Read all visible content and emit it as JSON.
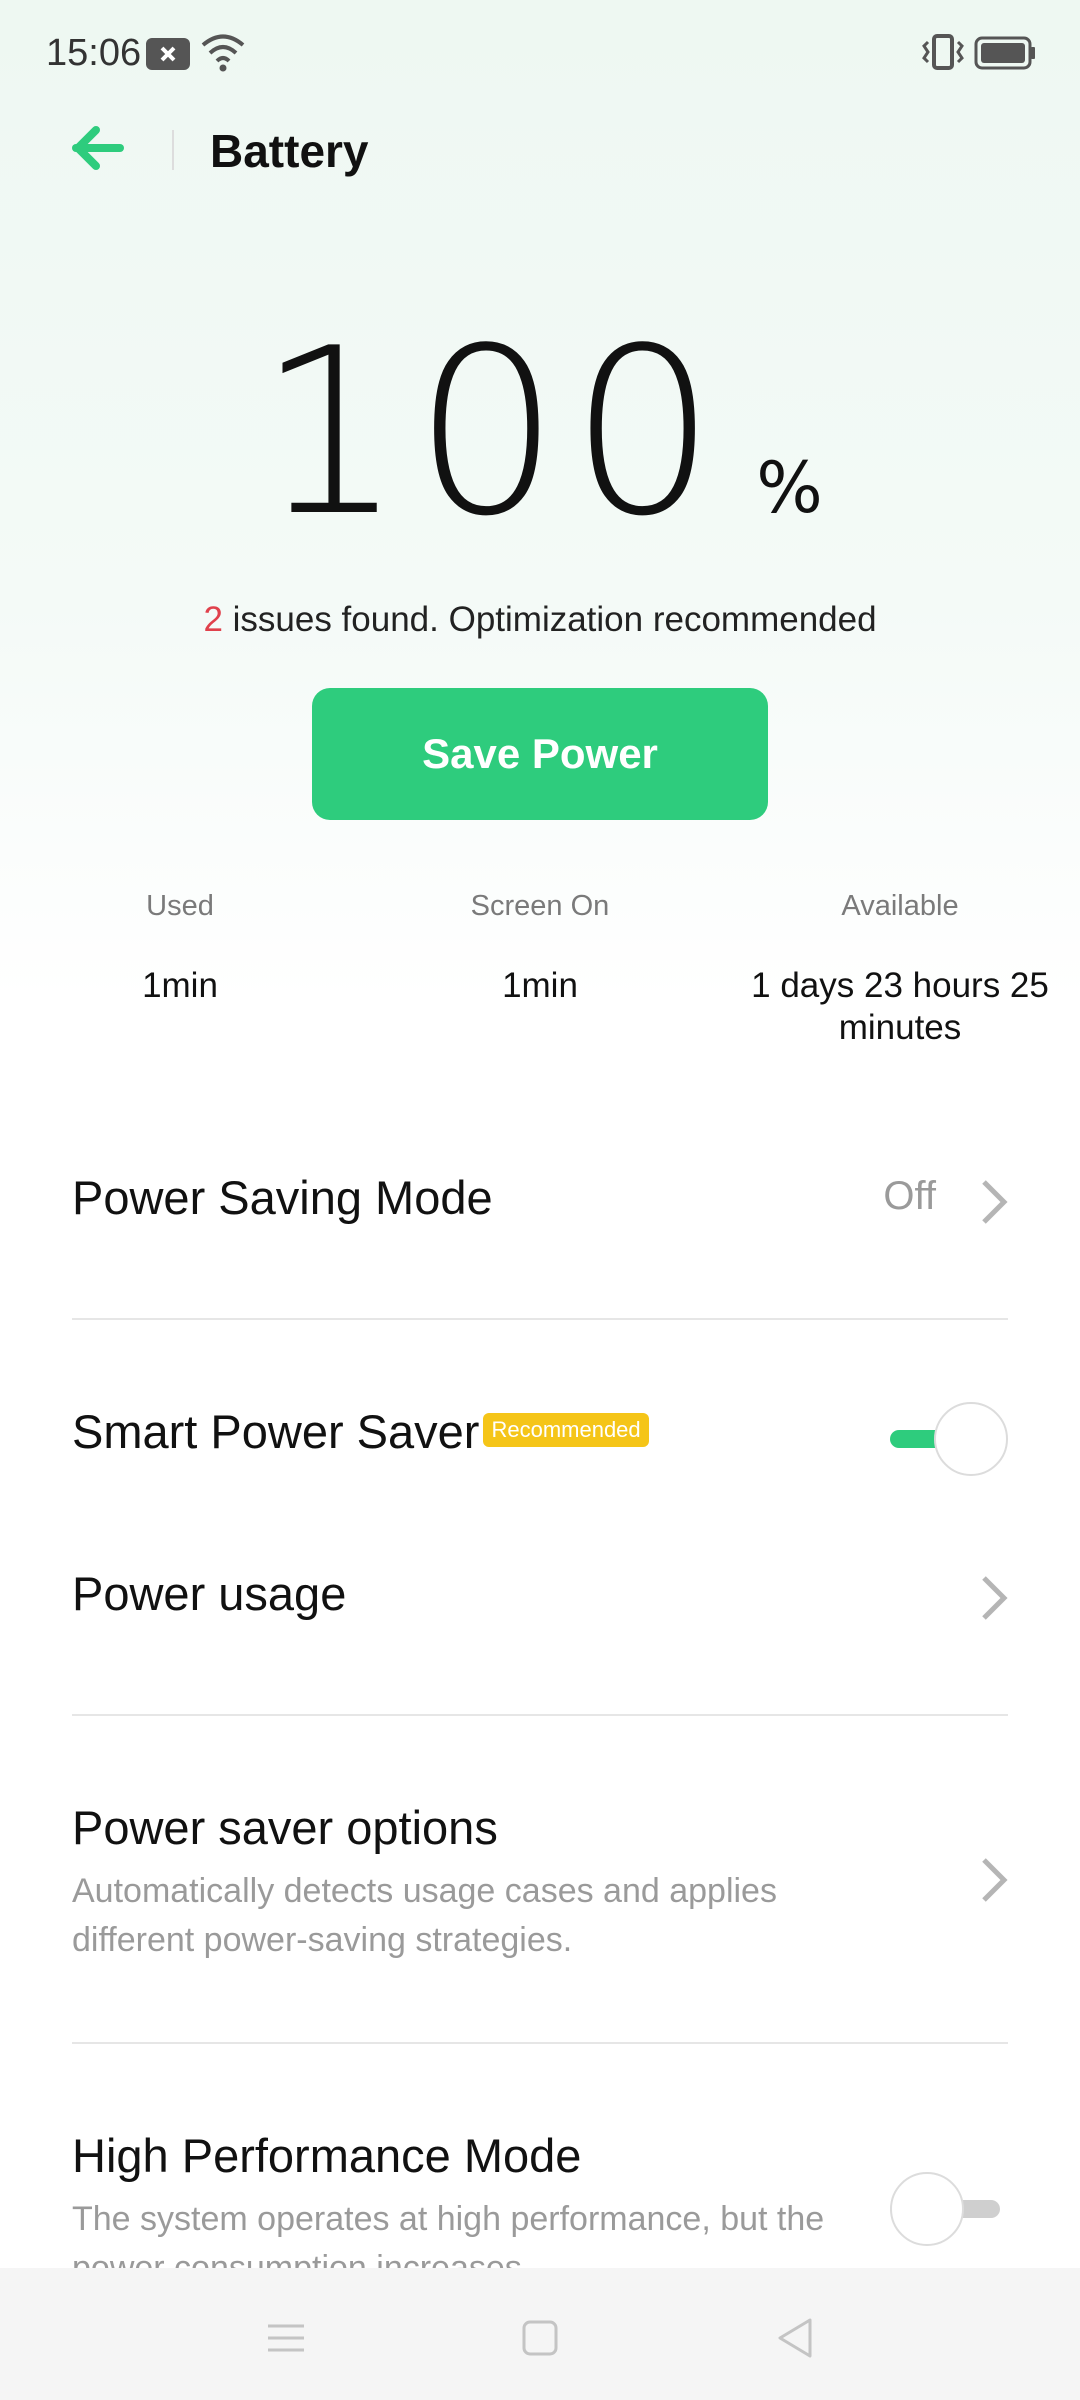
{
  "status_bar": {
    "time": "15:06",
    "icons": [
      "notification-x-icon",
      "wifi-icon",
      "vibrate-icon",
      "battery-icon"
    ]
  },
  "header": {
    "title": "Battery",
    "back_icon": "arrow-left-icon"
  },
  "battery": {
    "percent": "100",
    "percent_sign": "%",
    "issues_count": "2",
    "issues_text": " issues found. Optimization recommended",
    "save_button": "Save Power"
  },
  "stats": [
    {
      "label": "Used",
      "value": "1min"
    },
    {
      "label": "Screen On",
      "value": "1min"
    },
    {
      "label": "Available",
      "value": "1 days 23 hours 25 minutes"
    }
  ],
  "settings": {
    "power_saving_mode": {
      "title": "Power Saving Mode",
      "value": "Off"
    },
    "smart_power_saver": {
      "title": "Smart Power Saver",
      "badge": "Recommended",
      "enabled": true
    },
    "power_usage": {
      "title": "Power usage"
    },
    "power_saver_options": {
      "title": "Power saver options",
      "subtitle": "Automatically detects usage cases and applies different power-saving strategies."
    },
    "high_performance_mode": {
      "title": "High Performance Mode",
      "subtitle": "The system operates at high performance, but the power consumption increases.",
      "enabled": false
    }
  },
  "colors": {
    "accent": "#2ecc7d",
    "alert": "#e0414c",
    "badge": "#f5c518"
  },
  "nav_bar": {
    "icons": [
      "menu-icon",
      "home-icon",
      "back-triangle-icon"
    ]
  }
}
